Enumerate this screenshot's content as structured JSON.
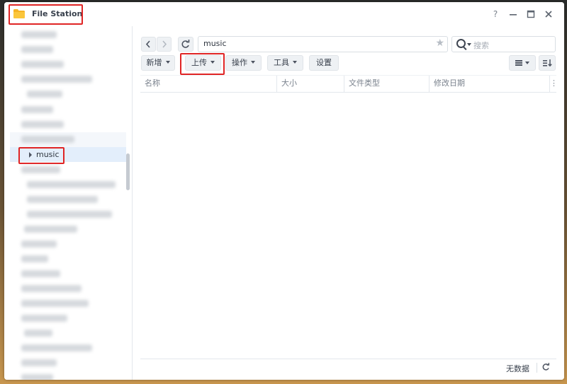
{
  "window": {
    "title": "File Station"
  },
  "sidebar": {
    "selected_label": "music"
  },
  "toolbar": {
    "path_value": "music",
    "search_placeholder": "搜索",
    "buttons": {
      "create": "新增",
      "upload": "上传",
      "action": "操作",
      "tools": "工具",
      "settings": "设置"
    }
  },
  "table": {
    "columns": [
      "名称",
      "大小",
      "文件类型",
      "修改日期"
    ]
  },
  "status": {
    "empty_text": "无数据"
  },
  "colors": {
    "accent": "#e3eefb",
    "highlight_box": "#e02424",
    "folder": "#f5b324"
  },
  "icons": [
    "folder-icon",
    "help-icon",
    "minimize-icon",
    "maximize-icon",
    "close-icon",
    "back-icon",
    "forward-icon",
    "refresh-icon",
    "star-icon",
    "search-icon",
    "list-view-icon",
    "sort-icon"
  ]
}
